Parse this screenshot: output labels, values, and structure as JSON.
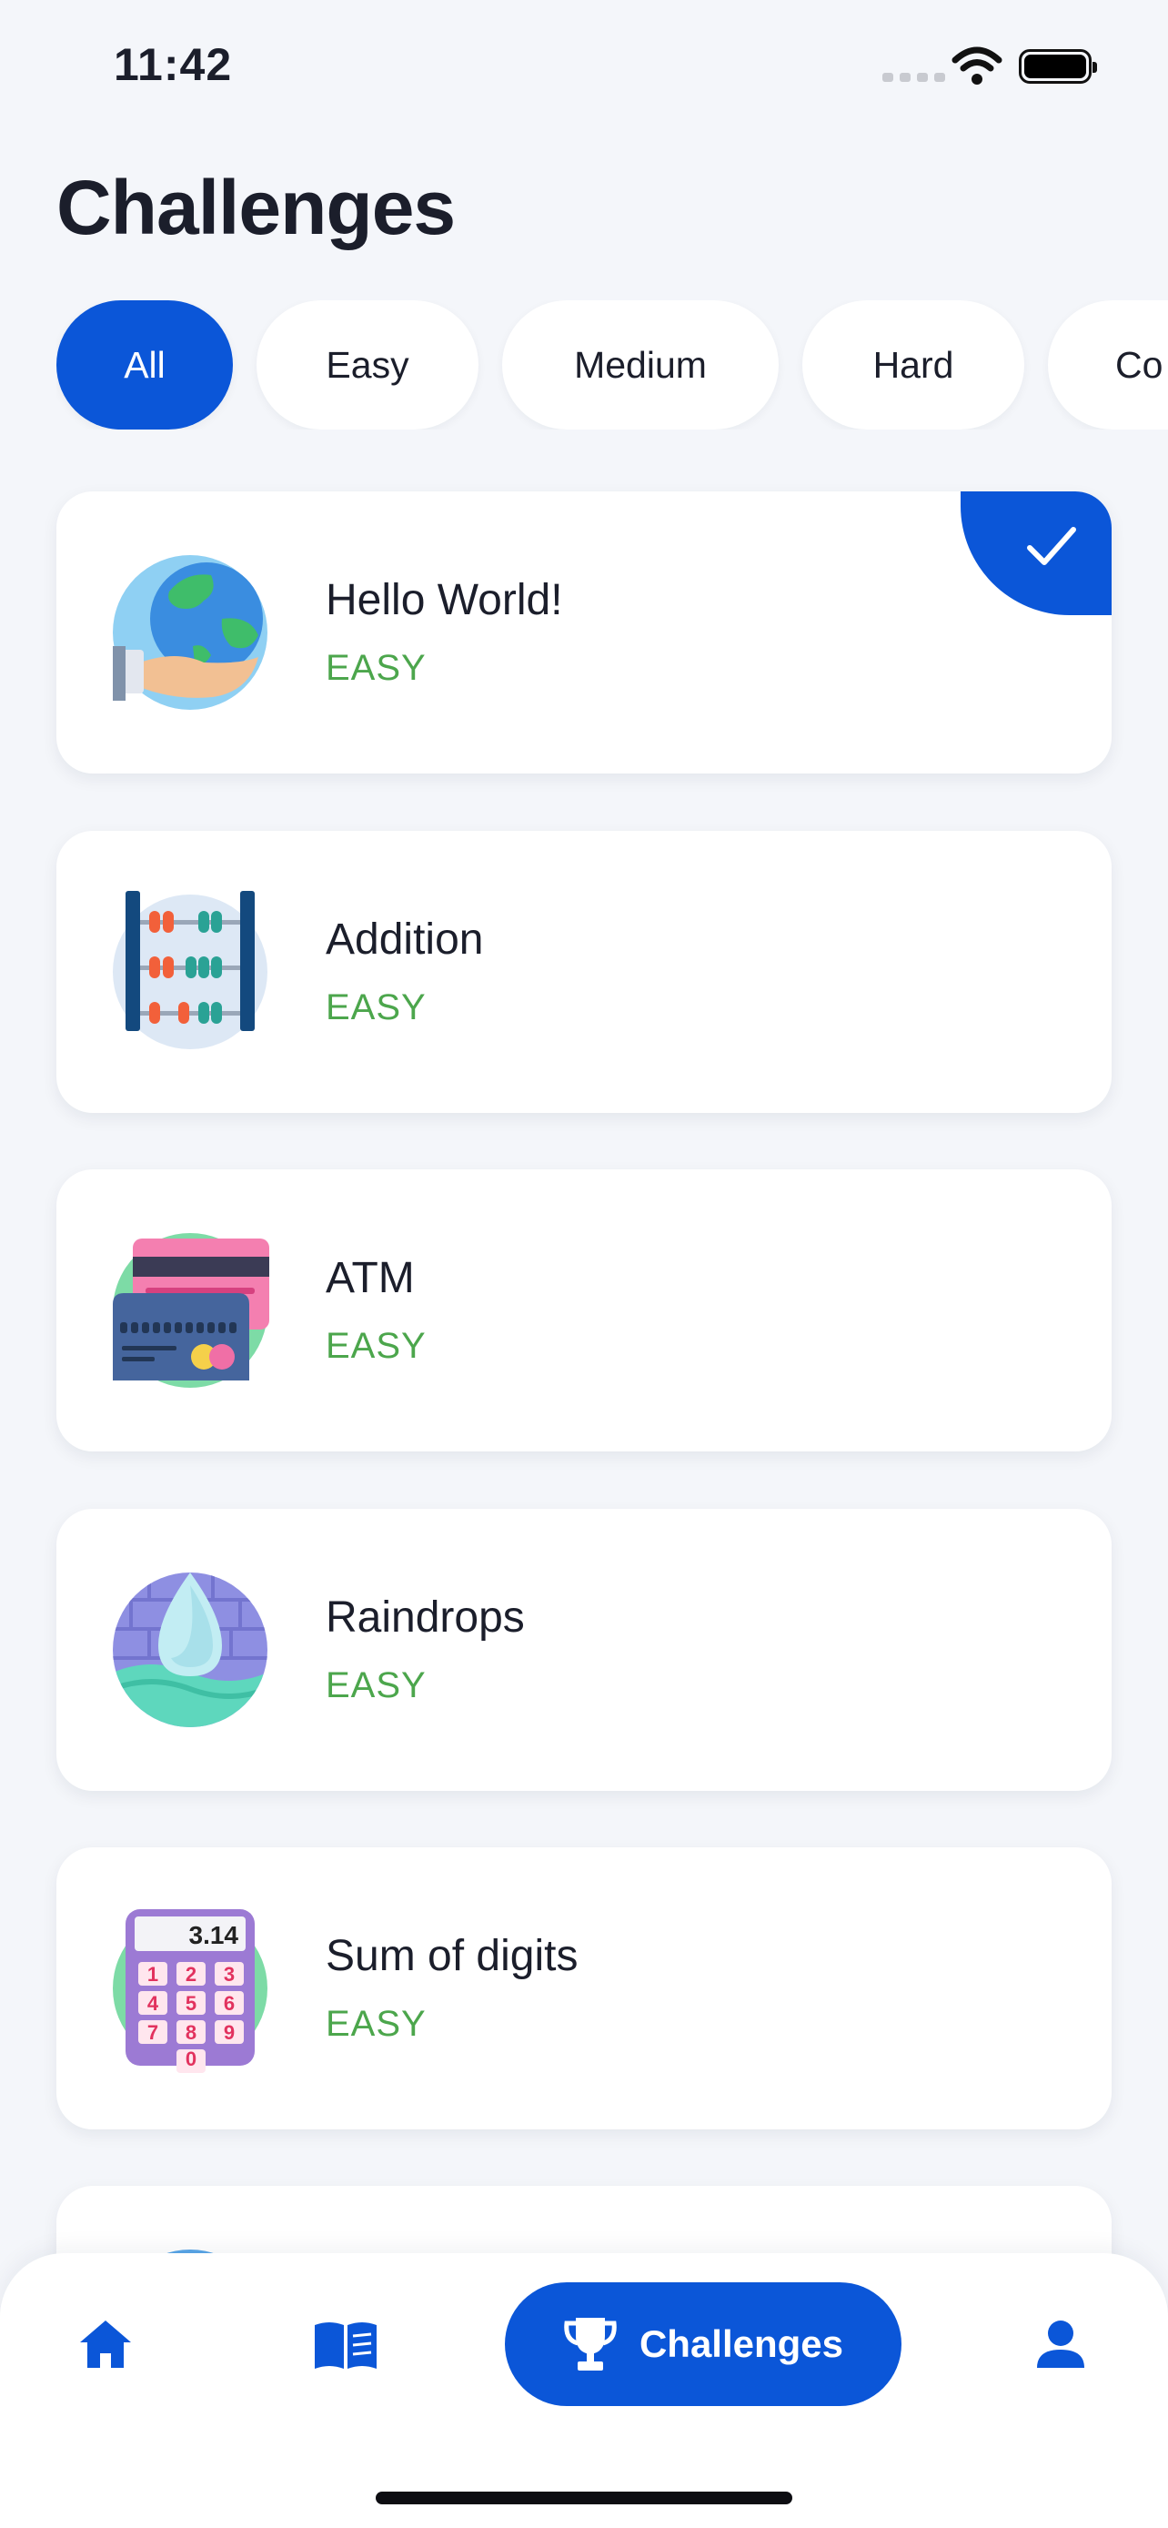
{
  "status_bar": {
    "time": "11:42"
  },
  "page": {
    "title": "Challenges"
  },
  "filters": [
    {
      "label": "All",
      "active": true
    },
    {
      "label": "Easy",
      "active": false
    },
    {
      "label": "Medium",
      "active": false
    },
    {
      "label": "Hard",
      "active": false
    },
    {
      "label": "Co",
      "active": false
    }
  ],
  "challenges": [
    {
      "title": "Hello World!",
      "level": "EASY",
      "icon": "globe-in-hand-icon",
      "completed": true
    },
    {
      "title": "Addition",
      "level": "EASY",
      "icon": "abacus-icon",
      "completed": false
    },
    {
      "title": "ATM",
      "level": "EASY",
      "icon": "credit-cards-icon",
      "completed": false
    },
    {
      "title": "Raindrops",
      "level": "EASY",
      "icon": "water-drop-icon",
      "completed": false
    },
    {
      "title": "Sum of digits",
      "level": "EASY",
      "icon": "calculator-icon",
      "completed": false
    }
  ],
  "calculator_display": "3.14",
  "calculator_keys": [
    "1",
    "2",
    "3",
    "4",
    "5",
    "6",
    "7",
    "8",
    "9",
    "0"
  ],
  "nav": {
    "items": [
      {
        "icon": "home-icon"
      },
      {
        "icon": "book-icon"
      },
      {
        "icon": "trophy-icon",
        "label": "Challenges",
        "active": true
      },
      {
        "icon": "profile-icon"
      }
    ]
  },
  "colors": {
    "accent": "#0b56d8",
    "easy": "#4ca64c",
    "background": "#f4f6fa"
  }
}
